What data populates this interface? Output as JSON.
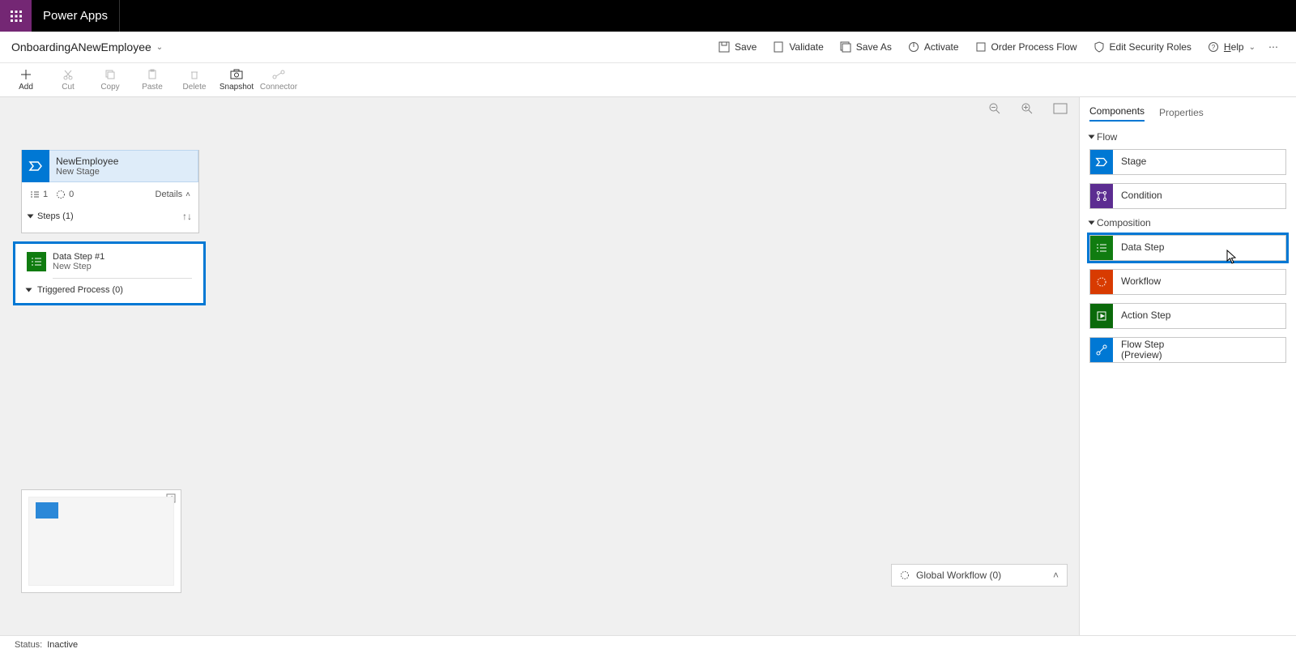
{
  "brand": "Power Apps",
  "flow_name": "OnboardingANewEmployee",
  "commands": {
    "save": "Save",
    "validate": "Validate",
    "save_as": "Save As",
    "activate": "Activate",
    "order": "Order Process Flow",
    "security": "Edit Security Roles",
    "help": "Help"
  },
  "toolbar": {
    "add": "Add",
    "cut": "Cut",
    "copy": "Copy",
    "paste": "Paste",
    "delete": "Delete",
    "snapshot": "Snapshot",
    "connector": "Connector"
  },
  "stage": {
    "title": "NewEmployee",
    "subtitle": "New Stage",
    "steps_count": "1",
    "wf_count": "0",
    "details": "Details",
    "steps_label": "Steps (1)",
    "triggered_label": "Triggered Process (0)"
  },
  "step": {
    "title": "Data Step #1",
    "subtitle": "New Step"
  },
  "global_workflow": "Global Workflow (0)",
  "panel": {
    "tab_components": "Components",
    "tab_properties": "Properties",
    "group_flow": "Flow",
    "group_composition": "Composition",
    "items": {
      "stage": "Stage",
      "condition": "Condition",
      "data_step": "Data Step",
      "workflow": "Workflow",
      "action_step": "Action Step",
      "flow_step": "Flow Step\n(Preview)"
    }
  },
  "status": {
    "label": "Status:",
    "value": "Inactive"
  }
}
